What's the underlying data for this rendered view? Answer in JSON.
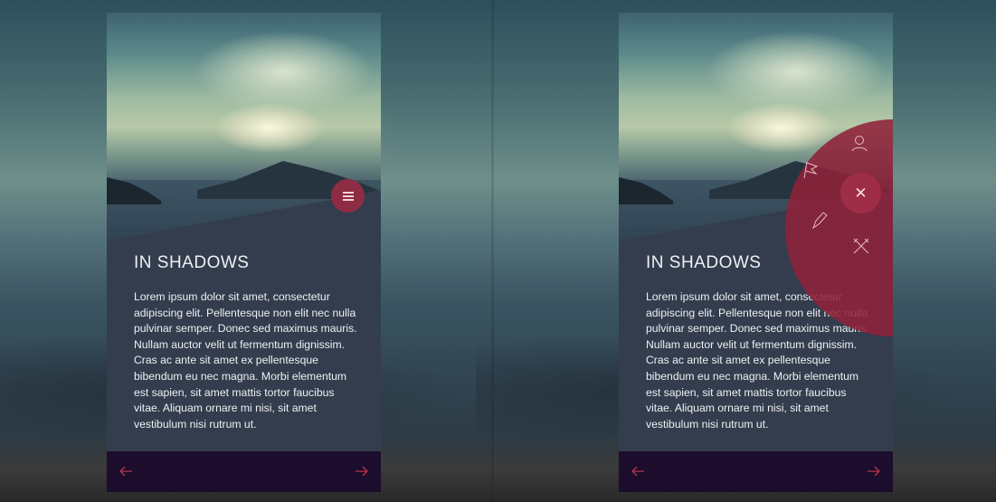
{
  "screens": [
    {
      "title": "IN SHADOWS",
      "body": "Lorem ipsum dolor sit amet, consectetur adipiscing elit. Pellentesque non elit nec nulla pulvinar semper. Donec sed maximus mauris. Nullam auctor velit ut fermentum dignissim. Cras ac ante sit amet ex pellentesque bibendum eu nec magna. Morbi elementum est sapien, sit amet mattis tortor faucibus vitae. Aliquam ornare mi nisi, sit amet vestibulum nisi rutrum ut.",
      "menu_state": "closed"
    },
    {
      "title": "IN SHADOWS",
      "body": "Lorem ipsum dolor sit amet, consectetur adipiscing elit. Pellentesque non elit nec nulla pulvinar semper. Donec sed maximus mauris. Nullam auctor velit ut fermentum dignissim. Cras ac ante sit amet ex pellentesque bibendum eu nec magna. Morbi elementum est sapien, sit amet mattis tortor faucibus vitae. Aliquam ornare mi nisi, sit amet vestibulum nisi rutrum ut.",
      "menu_state": "open",
      "radial_menu_items": [
        "user-icon",
        "flag-icon",
        "pencil-icon",
        "tools-icon"
      ]
    }
  ],
  "icons": {
    "menu": "hamburger-menu-icon",
    "close": "close-icon",
    "prev": "arrow-left-icon",
    "next": "arrow-right-icon"
  },
  "colors": {
    "card_bg": "#343d4d",
    "footer_bg": "#1d0d2c",
    "accent": "#8e2c43",
    "arrow": "#b8324f",
    "text": "#eef0f4"
  }
}
